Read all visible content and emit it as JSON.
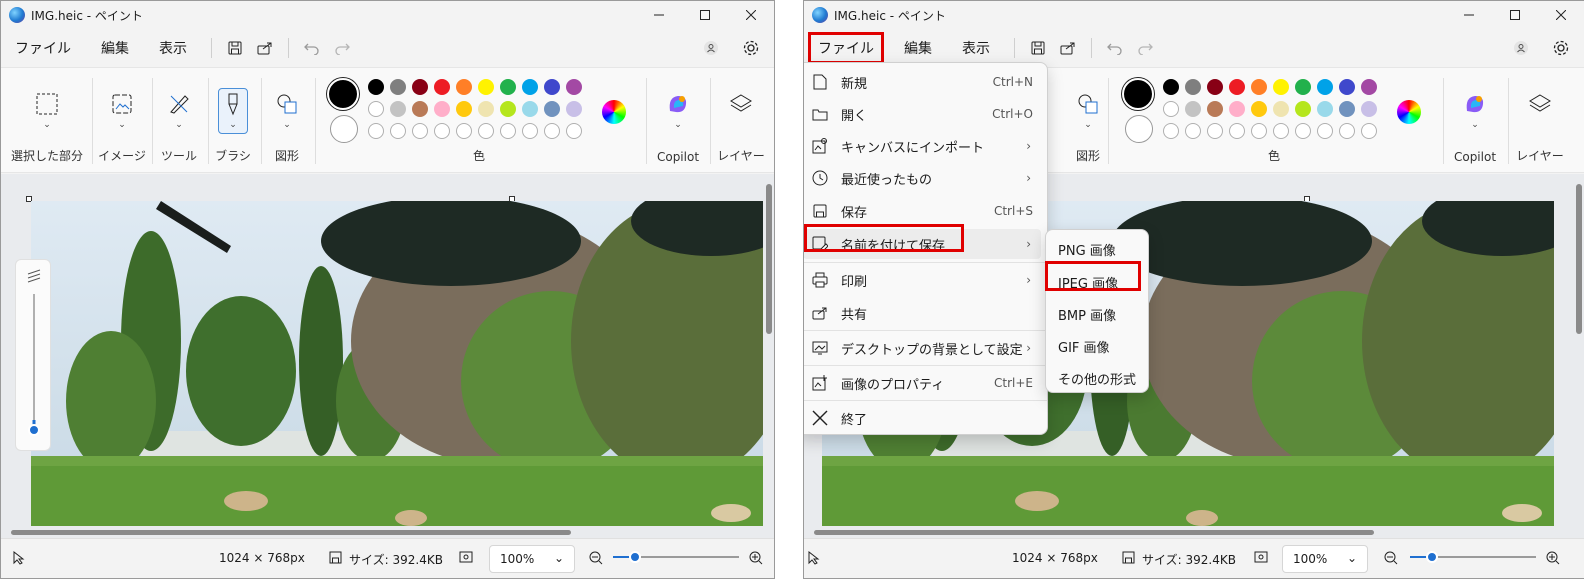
{
  "title": "IMG.heic - ペイント",
  "menu": {
    "file": "ファイル",
    "edit": "編集",
    "view": "表示"
  },
  "ribbon": {
    "selection": "選択した部分",
    "image": "イメージ",
    "tools": "ツール",
    "brush": "ブラシ",
    "shapes": "図形",
    "colors": "色",
    "copilot": "Copilot",
    "layers": "レイヤー"
  },
  "palette": {
    "primary": "#000000",
    "row1": [
      "#000000",
      "#7f7f7f",
      "#880015",
      "#ed1c24",
      "#ff7f27",
      "#fff200",
      "#22b14c",
      "#00a2e8",
      "#3f48cc",
      "#a349a4"
    ],
    "row2": [
      "#ffffff",
      "#c3c3c3",
      "#b97a57",
      "#ffaec9",
      "#ffc90e",
      "#efe4b0",
      "#b5e61d",
      "#99d9ea",
      "#7092be",
      "#c8bfe7"
    ]
  },
  "status": {
    "dimensions": "1024 × 768px",
    "size": "サイズ: 392.4KB",
    "zoom": "100%"
  },
  "file_menu": {
    "items": [
      {
        "label": "新規",
        "shortcut": "Ctrl+N"
      },
      {
        "label": "開く",
        "shortcut": "Ctrl+O"
      },
      {
        "label": "キャンバスにインポート",
        "shortcut": ""
      },
      {
        "label": "最近使ったもの",
        "shortcut": ""
      },
      {
        "label": "保存",
        "shortcut": "Ctrl+S"
      },
      {
        "label": "名前を付けて保存",
        "shortcut": ""
      },
      {
        "label": "印刷",
        "shortcut": ""
      },
      {
        "label": "共有",
        "shortcut": ""
      },
      {
        "label": "デスクトップの背景として設定",
        "shortcut": ""
      },
      {
        "label": "画像のプロパティ",
        "shortcut": "Ctrl+E"
      },
      {
        "label": "終了",
        "shortcut": ""
      }
    ]
  },
  "save_as_menu": {
    "items": [
      "PNG 画像",
      "JPEG 画像",
      "BMP 画像",
      "GIF 画像",
      "その他の形式"
    ]
  }
}
